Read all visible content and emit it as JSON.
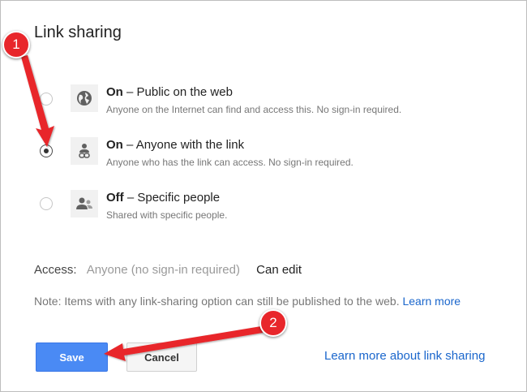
{
  "dialog": {
    "title": "Link sharing",
    "options": [
      {
        "title_bold": "On",
        "title_rest": " – Public on the web",
        "description": "Anyone on the Internet can find and access this. No sign-in required.",
        "icon": "globe-icon",
        "selected": false
      },
      {
        "title_bold": "On",
        "title_rest": " – Anyone with the link",
        "description": "Anyone who has the link can access. No sign-in required.",
        "icon": "link-person-icon",
        "selected": true
      },
      {
        "title_bold": "Off",
        "title_rest": " – Specific people",
        "description": "Shared with specific people.",
        "icon": "people-icon",
        "selected": false
      }
    ],
    "access": {
      "label": "Access:",
      "value": "Anyone (no sign-in required)",
      "permission": "Can edit"
    },
    "note": {
      "text": "Note: Items with any link-sharing option can still be published to the web.",
      "link": "Learn more"
    },
    "buttons": {
      "save": "Save",
      "cancel": "Cancel"
    },
    "learn_more_link": "Learn more about link sharing"
  },
  "annotations": {
    "marker_1": "1",
    "marker_2": "2",
    "color": "#e8262b"
  }
}
